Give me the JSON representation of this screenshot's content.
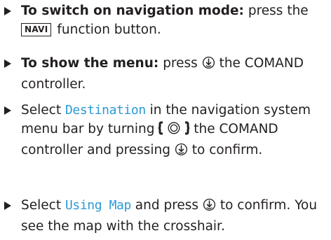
{
  "steps": [
    {
      "bold": "To switch on navigation mode:",
      "text_a": " press the",
      "key": "NAVI",
      "text_b": " function button."
    },
    {
      "bold": "To show the menu:",
      "text_a": " press ",
      "icon": "press-controller-icon",
      "text_b": " the COMAND controller."
    },
    {
      "text_a": "Select ",
      "softkey": "Destination",
      "text_b": " in the navigation system menu bar by turning ",
      "icon_turn": "turn-controller-icon",
      "text_c": " the COMAND controller and pressing ",
      "icon_press": "press-controller-icon",
      "text_d": " to confirm."
    },
    {
      "text_a": "Select ",
      "softkey": "Using Map",
      "text_b": " and press ",
      "icon": "press-controller-icon",
      "text_c": " to confirm. You see the map with the crosshair."
    }
  ],
  "colors": {
    "text": "#231f20",
    "softkey": "#2b9ad6"
  }
}
